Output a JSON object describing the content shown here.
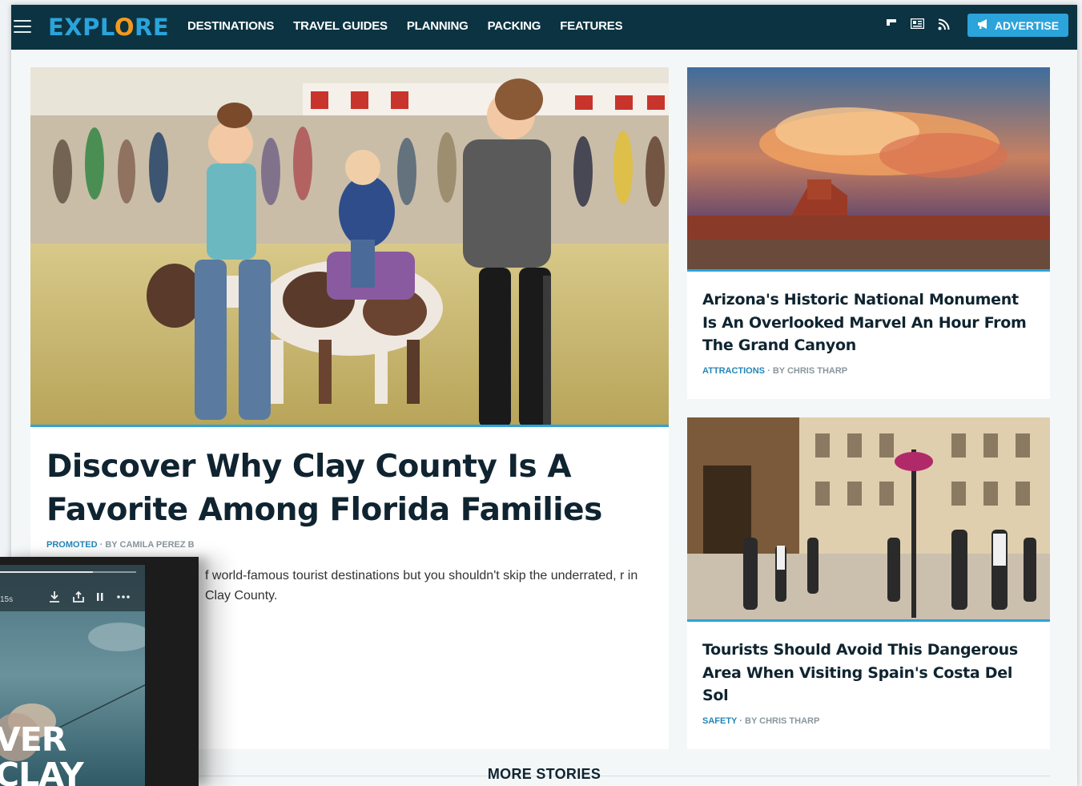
{
  "nav": {
    "logo": "EXPLORE",
    "links": [
      "DESTINATIONS",
      "TRAVEL GUIDES",
      "PLANNING",
      "PACKING",
      "FEATURES"
    ],
    "advertise_label": "ADVERTISE",
    "icons": [
      "flipboard-icon",
      "news-icon",
      "rss-icon",
      "megaphone-icon"
    ]
  },
  "main_article": {
    "title": "Discover Why Clay County Is A Favorite Among Florida Families",
    "category": "PROMOTED",
    "byline": "BY CAMILA PEREZ B",
    "excerpt": "f world-famous tourist destinations but you shouldn't skip the underrated, r in Clay County."
  },
  "side_articles": [
    {
      "title": "Arizona's Historic National Monument Is An Overlooked Marvel An Hour From The Grand Canyon",
      "category": "ATTRACTIONS",
      "byline": "BY CHRIS THARP"
    },
    {
      "title": "Tourists Should Avoid This Dangerous Area When Visiting Spain's Costa Del Sol",
      "category": "SAFETY",
      "byline": "BY CHRIS THARP"
    }
  ],
  "more_stories_label": "MORE STORIES",
  "video_player": {
    "time_label": "15s",
    "overlay_text_line1": "VER",
    "overlay_text_line2": "CLAY",
    "progress": 0.68
  },
  "colors": {
    "nav_bg": "#0b3342",
    "accent": "#2ba3db",
    "logo_o": "#f29a1e",
    "title": "#0f2430"
  }
}
